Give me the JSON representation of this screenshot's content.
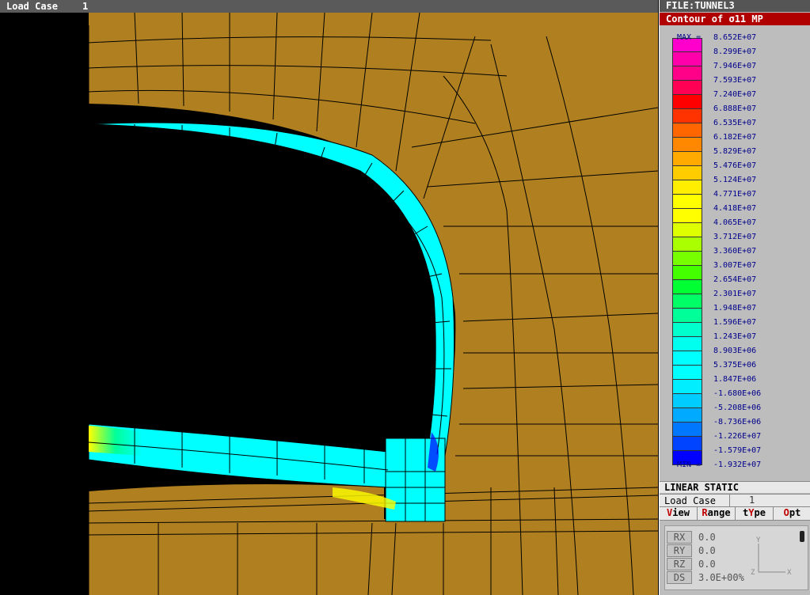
{
  "header": {
    "load_case_label": "Load Case",
    "load_case_value": "1"
  },
  "panel": {
    "file_title": "FILE:TUNNEL3",
    "contour_title": "Contour of σ11 MP",
    "legend": {
      "max_label": "MAX =",
      "min_label": "MIN =",
      "values": [
        "8.652E+07",
        "8.299E+07",
        "7.946E+07",
        "7.593E+07",
        "7.240E+07",
        "6.888E+07",
        "6.535E+07",
        "6.182E+07",
        "5.829E+07",
        "5.476E+07",
        "5.124E+07",
        "4.771E+07",
        "4.418E+07",
        "4.065E+07",
        "3.712E+07",
        "3.360E+07",
        "3.007E+07",
        "2.654E+07",
        "2.301E+07",
        "1.948E+07",
        "1.596E+07",
        "1.243E+07",
        "8.903E+06",
        "5.375E+06",
        "1.847E+06",
        "-1.680E+06",
        "-5.208E+06",
        "-8.736E+06",
        "-1.226E+07",
        "-1.579E+07",
        "-1.932E+07"
      ],
      "colors": [
        "#ff00cc",
        "#ff00aa",
        "#ff0088",
        "#ff0055",
        "#ff0000",
        "#ff3300",
        "#ff6600",
        "#ff8800",
        "#ffaa00",
        "#ffcc00",
        "#ffee00",
        "#ffff00",
        "#ffff00",
        "#ddff00",
        "#aaff00",
        "#77ff00",
        "#44ff00",
        "#00ff33",
        "#00ff66",
        "#00ff99",
        "#00ffcc",
        "#00ffee",
        "#00ffff",
        "#00ffff",
        "#00eeff",
        "#00ccff",
        "#00aaff",
        "#0077ff",
        "#0044ff",
        "#0000ff"
      ]
    },
    "analysis_type": "LINEAR STATIC",
    "load_case_label": "Load Case",
    "load_case_value": "1",
    "menu": {
      "view": {
        "hot": "V",
        "rest": "iew"
      },
      "range": {
        "hot": "R",
        "rest": "ange"
      },
      "type": {
        "pre": "t",
        "hot": "Y",
        "rest": "pe"
      },
      "opt": {
        "hot": "O",
        "rest": "pt"
      }
    },
    "view_controls": [
      {
        "key": "RX",
        "value": "0.0"
      },
      {
        "key": "RY",
        "value": "0.0"
      },
      {
        "key": "RZ",
        "value": "0.0"
      },
      {
        "key": "DS",
        "value": "3.0E+00%"
      }
    ],
    "axes": {
      "y": "Y",
      "z": "Z",
      "x": "X"
    }
  },
  "colors": {
    "rock": "#b08020",
    "lining": "#00ffff",
    "mesh": "#000000"
  }
}
